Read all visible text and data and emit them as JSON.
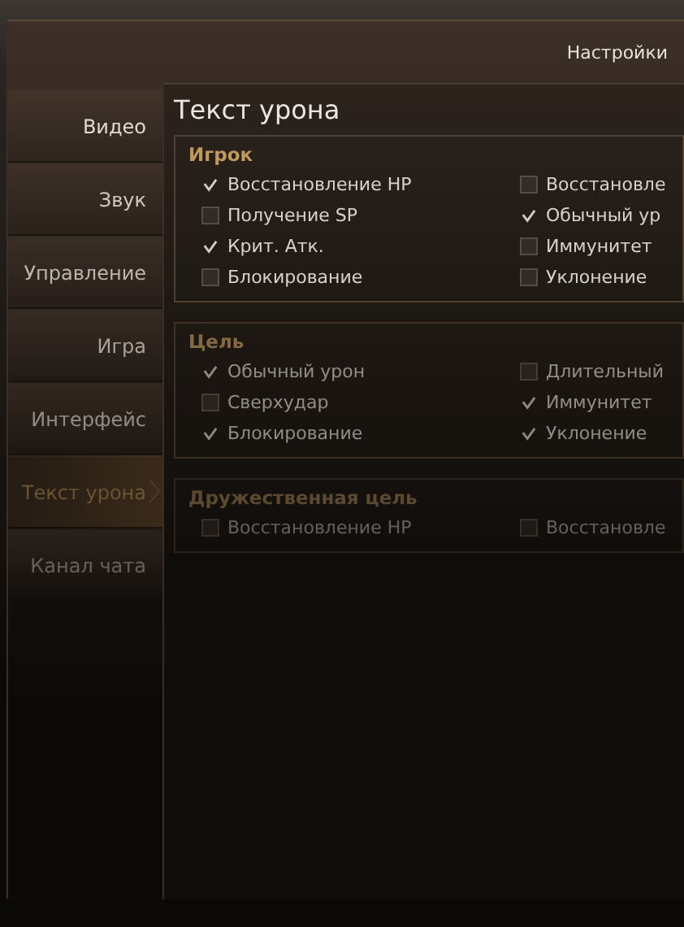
{
  "window": {
    "title": "Настройки"
  },
  "sidebar": {
    "items": [
      {
        "label": "Видео",
        "selected": false
      },
      {
        "label": "Звук",
        "selected": false
      },
      {
        "label": "Управление",
        "selected": false
      },
      {
        "label": "Игра",
        "selected": false
      },
      {
        "label": "Интерфейс",
        "selected": false
      },
      {
        "label": "Текст урона",
        "selected": true
      },
      {
        "label": "Канал чата",
        "selected": false
      }
    ]
  },
  "panel": {
    "title": "Текст урона",
    "groups": [
      {
        "title": "Игрок",
        "options": [
          {
            "label": "Восстановление HP",
            "checked": true
          },
          {
            "label": "Восстановле",
            "checked": false
          },
          {
            "label": "Получение SP",
            "checked": false
          },
          {
            "label": "Обычный ур",
            "checked": true
          },
          {
            "label": "Крит. Атк.",
            "checked": true
          },
          {
            "label": "Иммунитет",
            "checked": false
          },
          {
            "label": "Блокирование",
            "checked": false
          },
          {
            "label": "Уклонение",
            "checked": false
          }
        ]
      },
      {
        "title": "Цель",
        "options": [
          {
            "label": "Обычный урон",
            "checked": true
          },
          {
            "label": "Длительный",
            "checked": false
          },
          {
            "label": "Сверхудар",
            "checked": false
          },
          {
            "label": "Иммунитет",
            "checked": true
          },
          {
            "label": "Блокирование",
            "checked": true
          },
          {
            "label": "Уклонение",
            "checked": true
          }
        ]
      },
      {
        "title": "Дружественная цель",
        "options": [
          {
            "label": "Восстановление HP",
            "checked": false
          },
          {
            "label": "Восстановле",
            "checked": false
          }
        ]
      }
    ]
  }
}
